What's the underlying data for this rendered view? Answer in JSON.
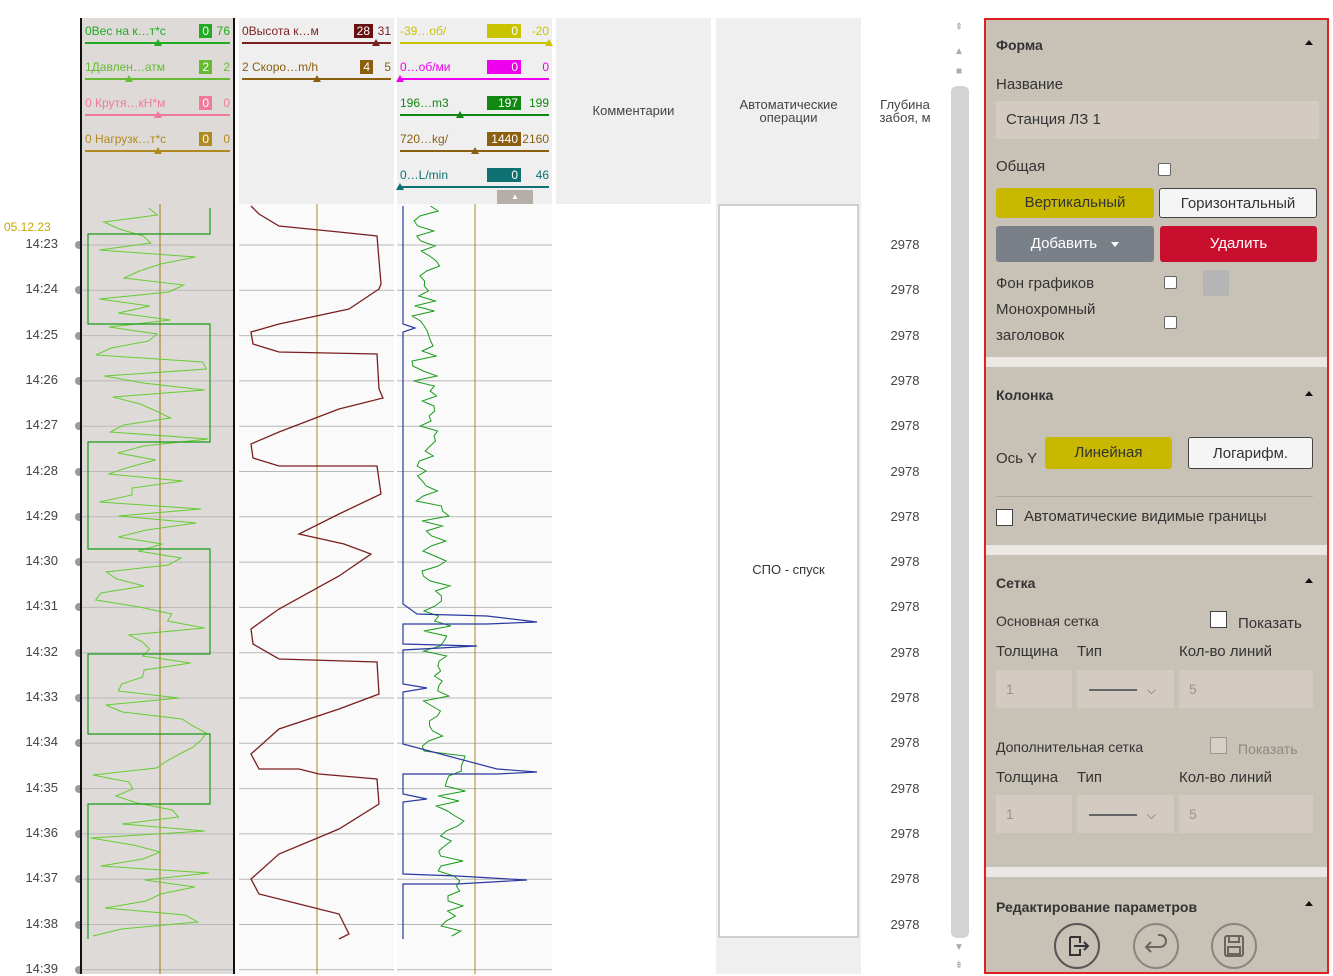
{
  "time_axis": {
    "date": "05.12.23",
    "times": [
      "14:23",
      "14:24",
      "14:25",
      "14:26",
      "14:27",
      "14:28",
      "14:29",
      "14:30",
      "14:31",
      "14:32",
      "14:33",
      "14:34",
      "14:35",
      "14:36",
      "14:37",
      "14:38",
      "14:39"
    ]
  },
  "track1": {
    "params": [
      {
        "name": "0Вес на к…т*с",
        "value": "0",
        "max": "76",
        "color": "#22aa22",
        "badge": "#22aa22",
        "marker": 0.5
      },
      {
        "name": "1Давлен…атм",
        "value": "2",
        "max": "2",
        "color": "#66bb33",
        "badge": "#66bb33",
        "marker": 0.3
      },
      {
        "name": "0 Крутя…кН*м",
        "value": "0",
        "max": "0",
        "color": "#f07a9a",
        "badge": "#f07a9a",
        "marker": 0.5
      },
      {
        "name": "0 Нагрузк…т*с",
        "value": "0",
        "max": "0",
        "color": "#b08a20",
        "badge": "#b08a20",
        "marker": 0.5
      }
    ]
  },
  "track2": {
    "params": [
      {
        "name": "0Высота к…м",
        "value": "28",
        "max": "31",
        "color": "#7a1f1f",
        "badge": "#6a1010",
        "marker": 0.9
      },
      {
        "name": "2 Скоро…m/h",
        "value": "4",
        "max": "5",
        "color": "#8a6010",
        "badge": "#8a6010",
        "marker": 0.5
      }
    ]
  },
  "track3": {
    "params": [
      {
        "name": "-39…об/",
        "value": "0",
        "max": "-20",
        "color": "#c9c400",
        "badge": "#c9c400",
        "marker": 1.0
      },
      {
        "name": "0…об/ми",
        "value": "0",
        "max": "0",
        "color": "#ee00ee",
        "badge": "#ee00ee",
        "marker": 0.0
      },
      {
        "name": "196…m3",
        "value": "197",
        "max": "199",
        "color": "#118811",
        "badge": "#118811",
        "marker": 0.4
      },
      {
        "name": "720…kg/",
        "value": "1440",
        "max": "2160",
        "color": "#8a6010",
        "badge": "#8a6010",
        "marker": 0.5
      },
      {
        "name": "0…L/min",
        "value": "0",
        "max": "46",
        "color": "#0e7070",
        "badge": "#0e7070",
        "marker": 0.0
      }
    ]
  },
  "track4": {
    "title": "Комментарии"
  },
  "track5": {
    "title": "Автоматические операции",
    "operation": "СПО - спуск"
  },
  "track6": {
    "title": "Глубина забоя, м",
    "depths": [
      "2978",
      "2978",
      "2978",
      "2978",
      "2978",
      "2978",
      "2978",
      "2978",
      "2978",
      "2978",
      "2978",
      "2978",
      "2978",
      "2978",
      "2978",
      "2978"
    ]
  },
  "panel": {
    "forma": {
      "title": "Форма",
      "name_label": "Название",
      "name_value": "Станция ЛЗ 1",
      "common_label": "Общая",
      "btn_vertical": "Вертикальный",
      "btn_horizontal": "Горизонтальный",
      "btn_add": "Добавить",
      "btn_delete": "Удалить",
      "bg_label": "Фон графиков",
      "mono_label_1": "Монохромный",
      "mono_label_2": "заголовок"
    },
    "kolonka": {
      "title": "Колонка",
      "axis_label": "Ось Y",
      "btn_linear": "Линейная",
      "btn_log": "Логарифм.",
      "auto_bounds": "Автоматические видимые границы"
    },
    "setka": {
      "title": "Сетка",
      "main_grid": "Основная сетка",
      "show": "Показать",
      "thickness": "Толщина",
      "type": "Тип",
      "lines_count": "Кол-во линий",
      "main_thickness": "1",
      "main_lines": "5",
      "extra_grid": "Дополнительная сетка",
      "extra_show": "Показать",
      "extra_thickness": "1",
      "extra_lines": "5"
    },
    "edit": {
      "title": "Редактирование параметров"
    }
  }
}
